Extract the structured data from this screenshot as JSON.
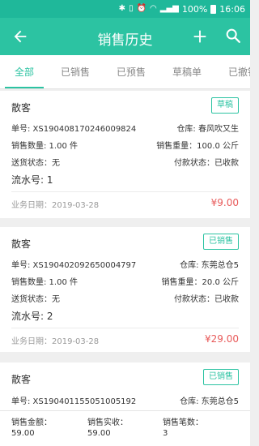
{
  "status_bar": {
    "battery_text": "100%",
    "time": "16:06"
  },
  "app_bar": {
    "title": "销售历史"
  },
  "tabs": [
    {
      "label": "全部",
      "active": true
    },
    {
      "label": "已销售",
      "active": false
    },
    {
      "label": "已预售",
      "active": false
    },
    {
      "label": "草稿单",
      "active": false
    },
    {
      "label": "已撤销",
      "active": false
    }
  ],
  "orders": [
    {
      "customer": "散客",
      "badge": "草稿",
      "order_no": "单号: XS190408170246009824",
      "warehouse": "仓库: 春风吹又生",
      "quantity": "销售数量: 1.00 件",
      "weight": "销售重量：100.0 公斤",
      "delivery": "送货状态：无",
      "payment": "付款状态：已收款",
      "serial": "流水号: 1",
      "date": "业务日期：2019-03-28",
      "amount": "¥9.00"
    },
    {
      "customer": "散客",
      "badge": "已销售",
      "order_no": "单号: XS190402092650004797",
      "warehouse": "仓库: 东莞总仓5",
      "quantity": "销售数量: 1.00 件",
      "weight": "销售重量：20.0 公斤",
      "delivery": "送货状态：无",
      "payment": "付款状态：已收款",
      "serial": "流水号: 2",
      "date": "业务日期：2019-03-28",
      "amount": "¥29.00"
    },
    {
      "customer": "散客",
      "badge": "已销售",
      "order_no": "单号: XS190401155051005192",
      "warehouse": "仓库: 东莞总仓5"
    }
  ],
  "footer": {
    "sales_amount_label": "销售金额：",
    "sales_amount_value": "59.00",
    "received_label": "销售实收：",
    "received_value": "59.00",
    "count_label": "销售笔数：",
    "count_value": "3"
  },
  "colors": {
    "primary": "#2cc3a2",
    "status_bar": "#1fb89a",
    "amount": "#e85a5a"
  }
}
